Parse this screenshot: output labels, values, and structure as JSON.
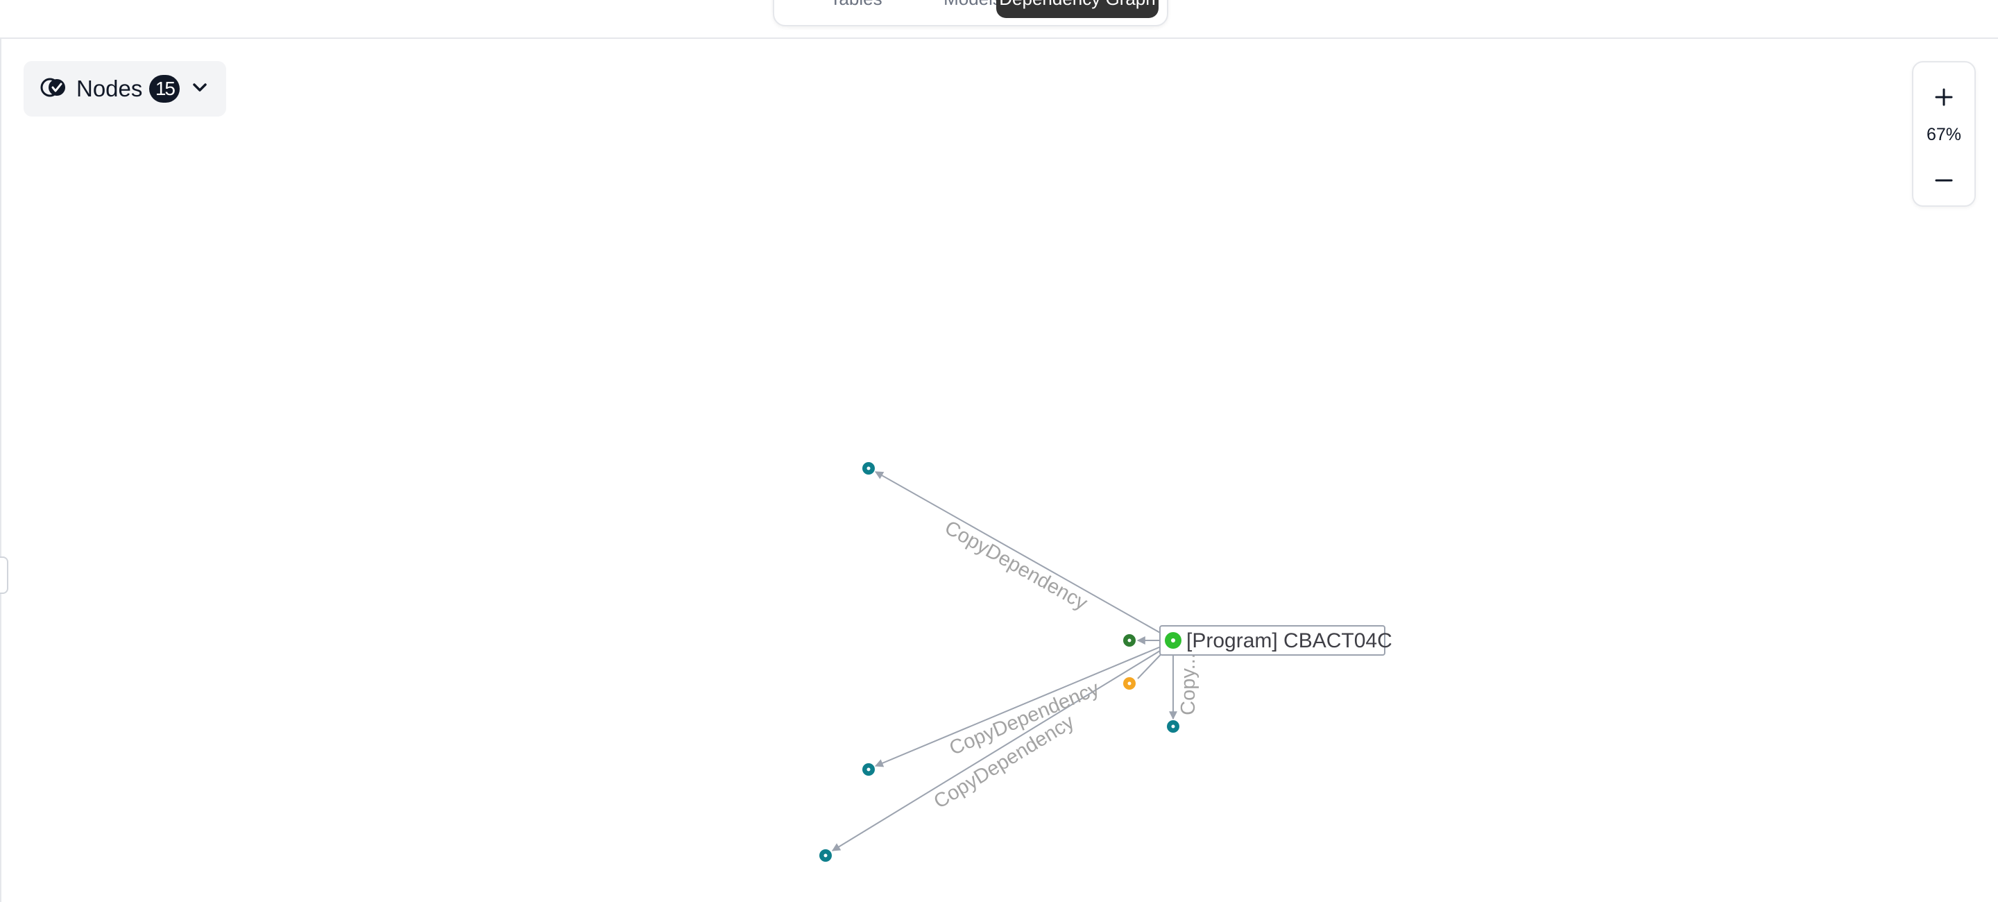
{
  "toolbar": {
    "tabs": [
      {
        "label": "Tables"
      },
      {
        "label": "Models"
      },
      {
        "label": "Dependency Graph"
      }
    ]
  },
  "filter": {
    "icon": "nodes-toggle-icon",
    "label": "Nodes",
    "count": "15"
  },
  "zoom": {
    "level": "67%"
  },
  "graph": {
    "selected_node_label": "[Program] CBACT04C",
    "edge_labels": {
      "upper_left": "CopyDependency",
      "down": "Copy...",
      "lower_left_1": "CopyDependency",
      "lower_left_2": "CopyDependency"
    },
    "colors": {
      "teal_node": "#0e7f8c",
      "selected_node": "#2fbf2f",
      "dark_green_node": "#2f7d32",
      "orange_node": "#f5a623",
      "edge": "#9ca3af"
    }
  }
}
